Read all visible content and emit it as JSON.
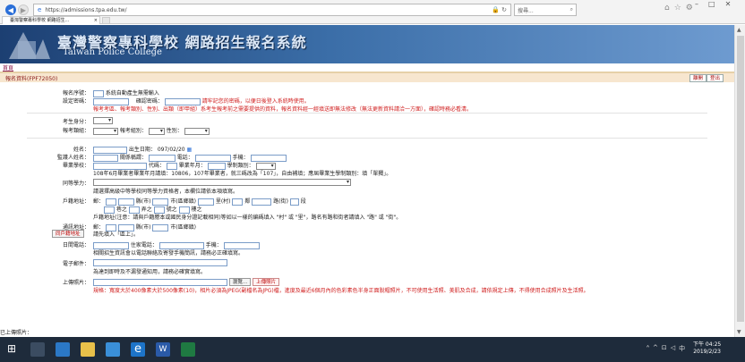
{
  "browser": {
    "url": "https://admissions.tpa.edu.tw/",
    "search_placeholder": "搜尋...",
    "tab_title": "臺灣警察專科學校 網路招生...",
    "tab_close": "×"
  },
  "banner": {
    "title_zh": "臺灣警察專科學校 網路招生報名系統",
    "title_en": "Taiwan Police College"
  },
  "home_link": "首頁",
  "section": {
    "title": "報名資料(FPF72050)",
    "btn_back": "離開",
    "btn_logout": "登出"
  },
  "form": {
    "id_no_label": "報名序號：",
    "id_no_note": "系統自動產生無需輸入",
    "password_label": "設定密碼：",
    "confirm_label": "確認密碼：",
    "password_note": "請牢記您的密碼，以便日後登入系統時使用。",
    "password_note2": "報考考區、報考類別、性別、出類（即甲組）系考生報考前之需要提供的資料，報名資料經一經填送即無法修改（無法更新資料請洽一方面），確認時務必看清。",
    "exam_identity_label": "考生身分：",
    "exam_category_label": "報考類組：",
    "subject_label": "報考組別：",
    "gender_label": "性別：",
    "name_label": "姓名：",
    "birth_label": "出生日期：",
    "birth_value": "097/02/20",
    "guardian_label": "監護人姓名：",
    "guardian_relation_label": "關係稱謂：",
    "phone_label": "電話：",
    "mobile_label": "手機：",
    "school_label": "畢業學校：",
    "school_code_label": "代碼：",
    "grad_year_label": "畢業年月：",
    "grad_class_label": "學制類別：",
    "school_note": "108年6月畢業者畢業年月請填：10806，107年畢業者，就三碼改為「107」，自由補填；應屆畢業生學制類別：填「單獨」。",
    "same_school_label": "同等學力：",
    "same_school_note": "請選擇高級中等學校同等學力資格者，本欄位請依本項填寫。",
    "address_label": "戶籍地址：",
    "postal_prefix": "郵：",
    "county_label": "縣(市)",
    "district_label": "市(區鄉鎮)",
    "village_label": "里(村)",
    "neighbor_label": "鄰",
    "road_label": "路(街)",
    "section_label": "段",
    "lane_label": "巷之",
    "alley_label": "弄之",
    "no_label": "號之",
    "floor_label": "樓之",
    "address_note": "戶籍地址(注意：請與戶籍謄本或國民身分證記載相同)等如以一樣的編碼填入 \"村\" 或 \"里\"，路名有路和街者請填入 \"路\" 或 \"街\"。",
    "mail_label": "通訊地址：",
    "mail_same_button": "同戶籍地址",
    "mail_note": "請先填入「區上」。",
    "day_phone_label": "日間電話：",
    "home_phone_label": "住家電話：",
    "mobile2_label": "手機：",
    "phone_note": "相關招生資訊會以電話聯絡及寄發手機簡訊，請務必正確填寫。",
    "email_label": "電子郵件：",
    "email_note": "為達到即時及不漏發通知用，請務必確實填寫。",
    "photo_label": "上傳照片：",
    "browse_button": "瀏覽...",
    "upload_button": "上傳照片",
    "photo_note": "規格：寬度大於400像素大於500像素(10)，相片必須為JPEG(副檔名為JPG)檔，進度及最近6個月內的色彩素色半身正面脫帽照片，不可使用生活照、美肌及合成，請依規定上傳，不得使用合成照片及生活照。",
    "uploaded_label": "已上傳照片："
  },
  "taskbar": {
    "time": "下午 04:25",
    "date": "2019/2/23"
  },
  "colors": {
    "banner_dark": "#1c3f72",
    "section_bar": "#f7e6cf",
    "note_red": "#d02020"
  }
}
